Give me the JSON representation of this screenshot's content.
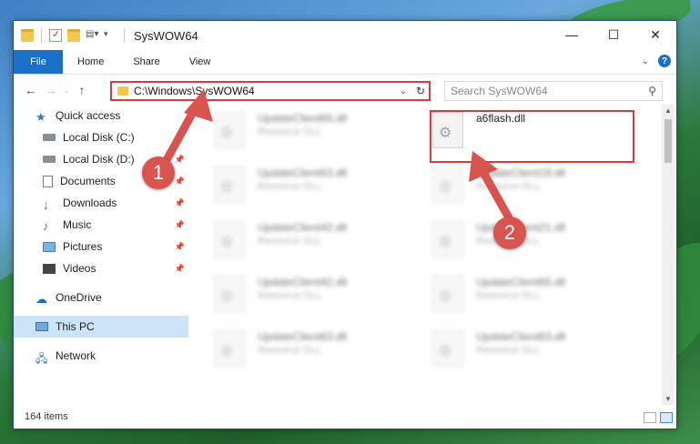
{
  "window": {
    "title": "SysWOW64",
    "controls": {
      "minimize": "—",
      "maximize": "☐",
      "close": "✕"
    }
  },
  "ribbon": {
    "tabs": [
      {
        "label": "File"
      },
      {
        "label": "Home"
      },
      {
        "label": "Share"
      },
      {
        "label": "View"
      }
    ],
    "help_label": "?"
  },
  "address": {
    "path": "C:\\Windows\\SysWOW64",
    "search_placeholder": "Search SysWOW64"
  },
  "sidebar": {
    "items": [
      {
        "label": "Quick access",
        "icon": "star-icon",
        "pinned": false
      },
      {
        "label": "Local Disk (C:)",
        "icon": "drive-icon",
        "pinned": true
      },
      {
        "label": "Local Disk (D:)",
        "icon": "drive-icon",
        "pinned": true
      },
      {
        "label": "Documents",
        "icon": "documents-icon",
        "pinned": true
      },
      {
        "label": "Downloads",
        "icon": "download-icon",
        "pinned": true
      },
      {
        "label": "Music",
        "icon": "music-icon",
        "pinned": true
      },
      {
        "label": "Pictures",
        "icon": "pictures-icon",
        "pinned": true
      },
      {
        "label": "Videos",
        "icon": "videos-icon",
        "pinned": true
      },
      {
        "label": "OneDrive",
        "icon": "cloud-icon",
        "pinned": false
      },
      {
        "label": "This PC",
        "icon": "computer-icon",
        "pinned": false
      },
      {
        "label": "Network",
        "icon": "network-icon",
        "pinned": false
      }
    ]
  },
  "files": {
    "left": [
      {
        "name": "UpdateClient65.dll",
        "type": "Resource DLL"
      },
      {
        "name": "UpdateClient63.dll",
        "type": "Resource DLL"
      },
      {
        "name": "UpdateClient42.dll",
        "type": "Resource DLL"
      },
      {
        "name": "UpdateClient42.dll",
        "type": "Resource DLL"
      },
      {
        "name": "UpdateClient63.dll",
        "type": "Resource DLL"
      }
    ],
    "right": [
      {
        "name": "a6flash.dll",
        "type": ""
      },
      {
        "name": "UpdateClient19.dll",
        "type": "Resource DLL"
      },
      {
        "name": "UpdateClient21.dll",
        "type": "Resource DLL"
      },
      {
        "name": "UpdateClient65.dll",
        "type": "Resource DLL"
      },
      {
        "name": "UpdateClient63.dll",
        "type": "Resource DLL"
      }
    ]
  },
  "status": {
    "item_count": "164 items"
  },
  "annotations": {
    "step1": "1",
    "step2": "2"
  },
  "colors": {
    "accent": "#1a6fc9",
    "highlight": "#d93a3a",
    "selected": "#cce4f7"
  }
}
